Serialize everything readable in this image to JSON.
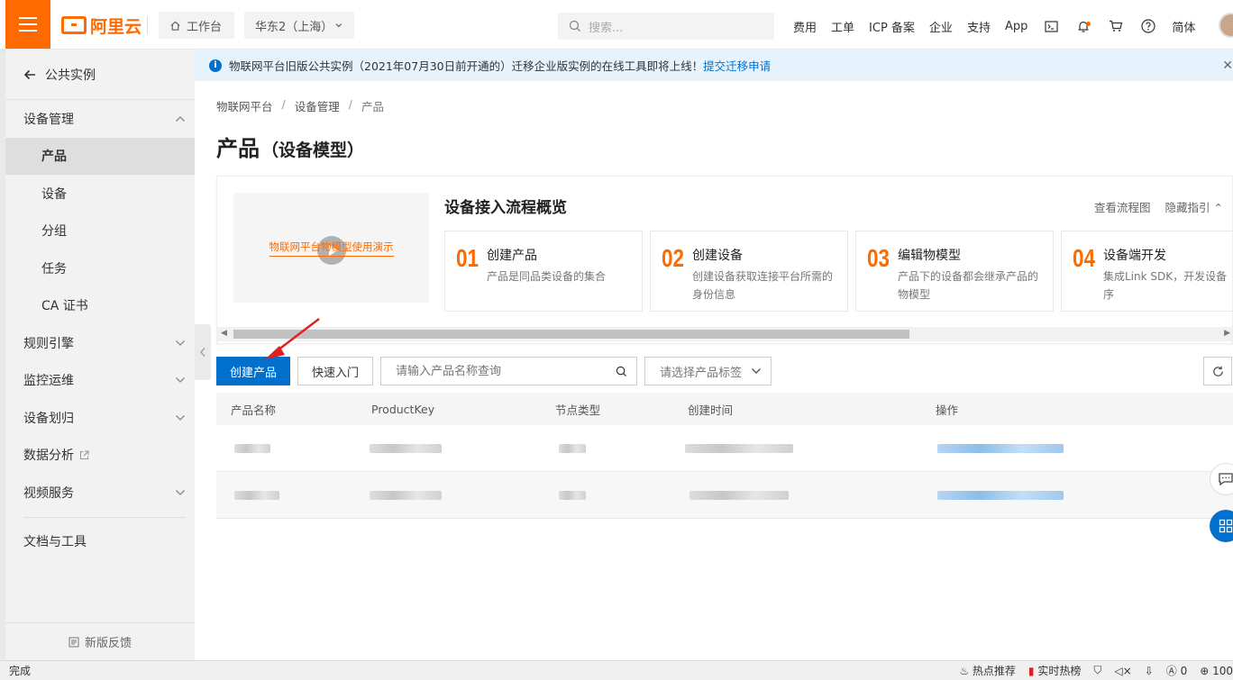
{
  "topbar": {
    "logo_text": "阿里云",
    "workbench_label": "工作台",
    "region_label": "华东2（上海）",
    "search_placeholder": "搜索...",
    "nav": [
      "费用",
      "工单",
      "ICP 备案",
      "企业",
      "支持",
      "App"
    ],
    "lang_label": "简体"
  },
  "sidebar": {
    "back_label": "公共实例",
    "items": [
      {
        "label": "设备管理",
        "icon": "chevron-up-icon"
      },
      {
        "label": "产品",
        "active": true
      },
      {
        "label": "设备"
      },
      {
        "label": "分组"
      },
      {
        "label": "任务"
      },
      {
        "label": "CA 证书"
      },
      {
        "label": "规则引擎",
        "icon": "chevron-down-icon"
      },
      {
        "label": "监控运维",
        "icon": "chevron-down-icon"
      },
      {
        "label": "设备划归",
        "icon": "chevron-down-icon"
      },
      {
        "label": "数据分析",
        "icon": "external-link-icon"
      },
      {
        "label": "视频服务",
        "icon": "chevron-down-icon"
      },
      {
        "label": "文档与工具"
      }
    ],
    "feedback_label": "新版反馈"
  },
  "notice": {
    "text": "物联网平台旧版公共实例（2021年07月30日前开通的）迁移企业版实例的在线工具即将上线！",
    "link": "提交迁移申请"
  },
  "breadcrumb": [
    "物联网平台",
    "设备管理",
    "产品"
  ],
  "page_title": {
    "main": "产品",
    "sub": "（设备模型）"
  },
  "guide": {
    "video_caption": "物联网平台物模型使用演示",
    "title": "设备接入流程概览",
    "links": [
      "查看流程图",
      "隐藏指引"
    ],
    "steps": [
      {
        "num": "01",
        "title": "创建产品",
        "desc": [
          "产品是同品类设备的集合"
        ]
      },
      {
        "num": "02",
        "title": "创建设备",
        "desc": [
          "创建设备获取连接平台所需的",
          "身份信息"
        ]
      },
      {
        "num": "03",
        "title": "编辑物模型",
        "desc": [
          "产品下的设备都会继承产品的",
          "物模型"
        ]
      },
      {
        "num": "04",
        "title": "设备端开发",
        "desc": [
          "集成Link SDK，开发设备",
          "序"
        ]
      }
    ]
  },
  "toolbar": {
    "create_label": "创建产品",
    "quickstart_label": "快速入门",
    "search_placeholder": "请输入产品名称查询",
    "tag_select_placeholder": "请选择产品标签"
  },
  "table": {
    "columns": [
      "产品名称",
      "ProductKey",
      "节点类型",
      "创建时间",
      "操作"
    ]
  },
  "statusbar": {
    "status": "完成",
    "items": [
      "热点推荐",
      "实时热榜",
      "0",
      "100"
    ]
  },
  "colors": {
    "brand": "#ff6a00",
    "primary": "#0070cc"
  }
}
